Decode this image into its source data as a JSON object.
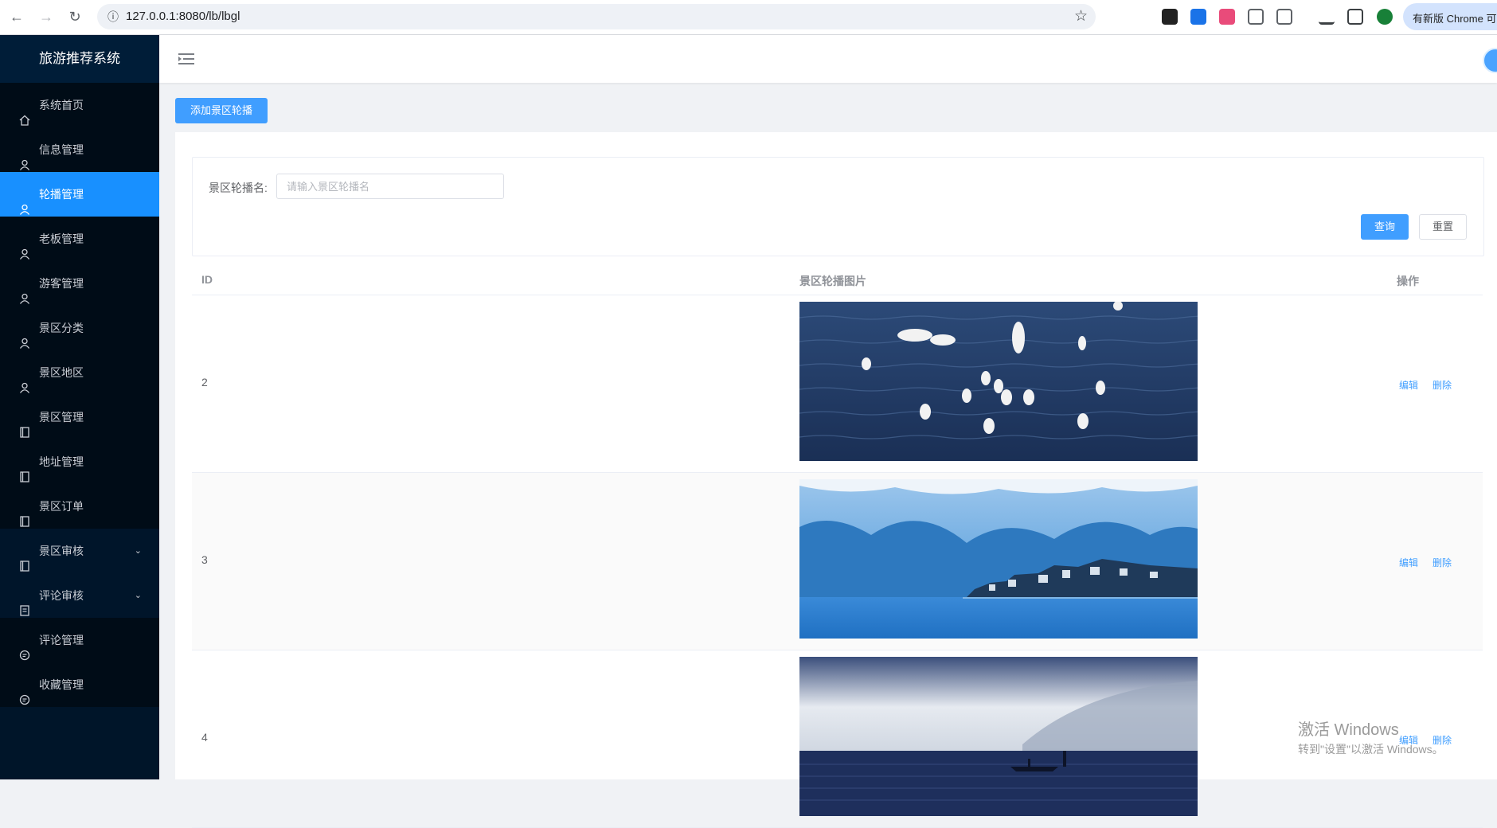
{
  "browser": {
    "url": "127.0.0.1:8080/lb/lbgl",
    "update_label": "有新版 Chrome 可用"
  },
  "sidebar": {
    "title": "旅游推荐系统",
    "items": [
      {
        "label": "系统首页",
        "icon": "home-icon"
      },
      {
        "label": "信息管理",
        "icon": "user-icon"
      },
      {
        "label": "轮播管理",
        "icon": "user-icon",
        "active": true
      },
      {
        "label": "老板管理",
        "icon": "user-icon"
      },
      {
        "label": "游客管理",
        "icon": "user-icon"
      },
      {
        "label": "景区分类",
        "icon": "user-icon"
      },
      {
        "label": "景区地区",
        "icon": "user-icon"
      },
      {
        "label": "景区管理",
        "icon": "notebook-icon"
      },
      {
        "label": "地址管理",
        "icon": "notebook-icon"
      },
      {
        "label": "景区订单",
        "icon": "notebook-icon"
      },
      {
        "label": "景区审核",
        "icon": "notebook-icon",
        "submenu": true
      },
      {
        "label": "评论审核",
        "icon": "document-icon",
        "submenu": true
      },
      {
        "label": "评论管理",
        "icon": "chat-icon"
      },
      {
        "label": "收藏管理",
        "icon": "chat-icon"
      }
    ]
  },
  "toolbar": {
    "add_label": "添加景区轮播"
  },
  "search": {
    "label": "景区轮播名:",
    "placeholder": "请输入景区轮播名",
    "query_label": "查询",
    "reset_label": "重置"
  },
  "table": {
    "headers": {
      "id": "ID",
      "image": "景区轮播图片",
      "actions": "操作"
    },
    "rows": [
      {
        "id": "2",
        "image": "seagulls-on-lake",
        "edit": "编辑",
        "delete": "删除"
      },
      {
        "id": "3",
        "image": "lake-town-mountains",
        "edit": "编辑",
        "delete": "删除"
      },
      {
        "id": "4",
        "image": "misty-lake-boat",
        "edit": "编辑",
        "delete": "删除"
      }
    ]
  },
  "watermark": {
    "line1": "激活 Windows",
    "line2": "转到\"设置\"以激活 Windows。"
  },
  "colors": {
    "sidebar_bg": "#001529",
    "active_bg": "#1890ff",
    "primary": "#409eff"
  }
}
